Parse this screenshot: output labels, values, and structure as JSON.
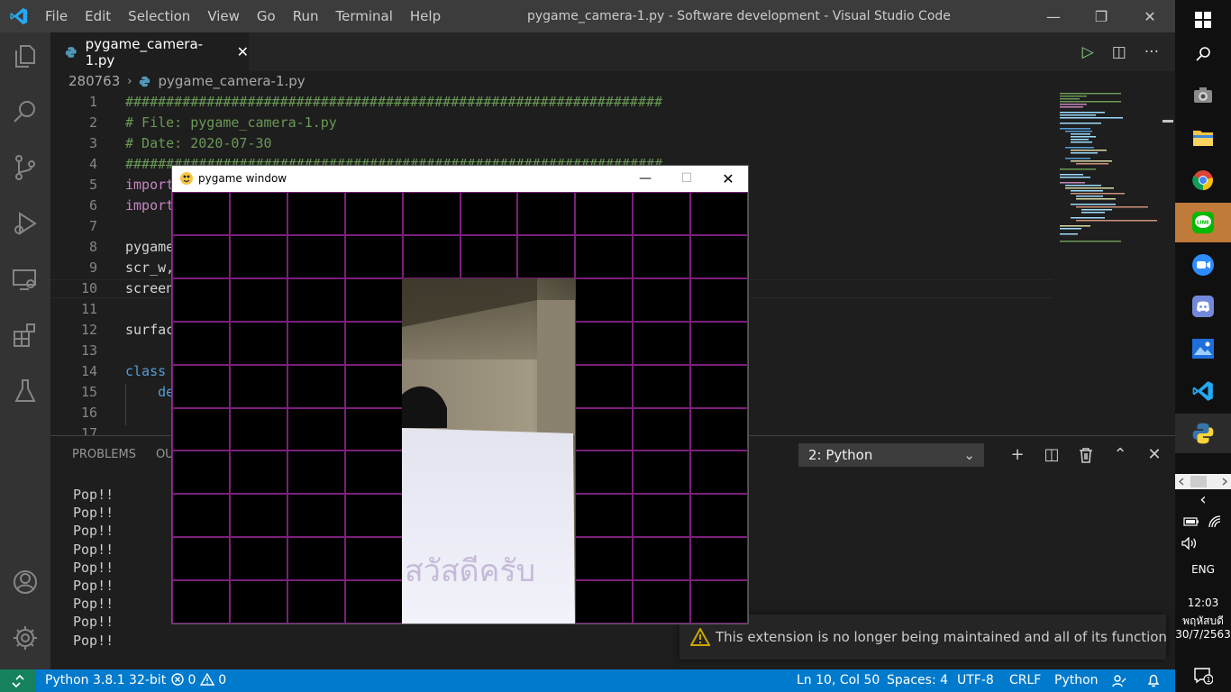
{
  "window": {
    "title": "pygame_camera-1.py - Software development - Visual Studio Code",
    "minimize": "—",
    "maximize": "❐",
    "close": "✕"
  },
  "menu": [
    "File",
    "Edit",
    "Selection",
    "View",
    "Go",
    "Run",
    "Terminal",
    "Help"
  ],
  "activity_icons": [
    "explorer-icon",
    "search-icon",
    "source-control-icon",
    "run-debug-icon",
    "remote-explorer-icon",
    "extensions-icon",
    "testing-icon",
    "accounts-icon",
    "settings-gear-icon"
  ],
  "tab": {
    "label": "pygame_camera-1.py",
    "close": "✕"
  },
  "tab_actions": {
    "run": "▷",
    "split": "◫",
    "more": "···"
  },
  "breadcrumb": {
    "folder": "280763",
    "separator": "›",
    "file": "pygame_camera-1.py"
  },
  "editor": {
    "line_numbers": [
      "1",
      "2",
      "3",
      "4",
      "5",
      "6",
      "7",
      "8",
      "9",
      "10",
      "11",
      "12",
      "13",
      "14",
      "15",
      "16",
      "17"
    ],
    "lines": [
      {
        "text": "##################################################################",
        "style": "comment"
      },
      {
        "text": "# File: pygame_camera-1.py",
        "style": "comment"
      },
      {
        "text": "# Date: 2020-07-30",
        "style": "comment"
      },
      {
        "text": "##################################################################",
        "style": "comment"
      },
      {
        "text": "import",
        "style": "kw2"
      },
      {
        "text": "import",
        "style": "kw2"
      },
      {
        "text": "",
        "style": "id"
      },
      {
        "text": "pygame",
        "style": "id"
      },
      {
        "text": "scr_w,",
        "style": "id"
      },
      {
        "text": "screen",
        "style": "id"
      },
      {
        "text": "",
        "style": "id"
      },
      {
        "text": "surfac",
        "style": "id"
      },
      {
        "text": "",
        "style": "id"
      },
      {
        "text": "class",
        "style": "kw"
      },
      {
        "text": "    de",
        "style": "kw"
      },
      {
        "text": "",
        "style": "id"
      },
      {
        "text": "",
        "style": "id"
      }
    ]
  },
  "panel": {
    "tabs": [
      "PROBLEMS",
      "OUT"
    ],
    "terminal_select": "2: Python",
    "terminal_chevron": "⌄",
    "actions": {
      "new": "+",
      "split": "◫",
      "kill": "🗑",
      "maximize": "⌃",
      "close": "✕"
    },
    "output": [
      "Pop!!",
      "Pop!!",
      "Pop!!",
      "Pop!!",
      "Pop!!",
      "Pop!!",
      "Pop!!",
      "Pop!!",
      "Pop!!"
    ]
  },
  "notification": {
    "text": "This extension is no longer being maintained and all of its functionalit..."
  },
  "statusbar": {
    "interpreter": "Python 3.8.1 32-bit",
    "errors": "0",
    "warnings": "0",
    "position": "Ln 10, Col 50",
    "spaces": "Spaces: 4",
    "encoding": "UTF-8",
    "eol": "CRLF",
    "language": "Python"
  },
  "pygame": {
    "title": "pygame window",
    "minimize": "—",
    "maximize": "☐",
    "close": "✕",
    "grid": {
      "columns": 10,
      "rows": 10,
      "line_color": "#7a1f7a"
    },
    "camera_handwriting": "สวัสดีครับ"
  },
  "taskbar": {
    "icons": [
      "windows-start-icon",
      "search-icon",
      "camera-app-icon",
      "file-explorer-icon",
      "chrome-icon",
      "line-app-icon",
      "zoom-icon",
      "discord-icon",
      "photos-icon",
      "vscode-icon",
      "python-icon"
    ],
    "tray": {
      "back": "‹",
      "language": "ENG",
      "time": "12:03",
      "day": "พฤหัสบดี",
      "date": "30/7/2563",
      "notifications": "1"
    }
  },
  "colors": {
    "accent": "#007acc",
    "remote": "#16825d",
    "comment": "#6a9955",
    "keyword": "#569cd6",
    "control_keyword": "#c586c0"
  }
}
